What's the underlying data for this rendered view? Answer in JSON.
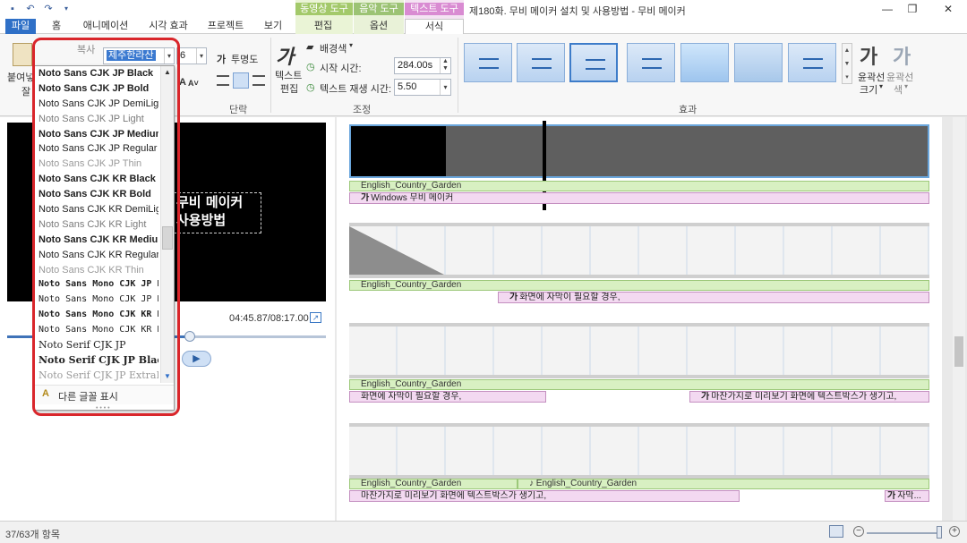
{
  "window": {
    "title": "제180화. 무비 메이커 설치 및 사용방법 - 무비 메이커",
    "min": "—",
    "max": "❐",
    "close": "✕"
  },
  "context_tabs": {
    "video": "동영상 도구",
    "audio": "음악 도구",
    "text": "텍스트 도구"
  },
  "tabs": [
    "파일",
    "홈",
    "애니메이션",
    "시각 효과",
    "프로젝트",
    "보기",
    "편집",
    "옵션",
    "서식"
  ],
  "ribbon": {
    "clipboard": {
      "paste": "붙여넣",
      "copy": "복사",
      "cut": "잘"
    },
    "font": {
      "current": "제주한라산",
      "size": "6",
      "transparency_label": "투명도"
    },
    "paragraph": {
      "label": "단락"
    },
    "adjust": {
      "label": "조정",
      "text_edit_1": "텍스트",
      "text_edit_2": "편집",
      "bg_color": "배경색",
      "start_time_label": "시작 시간:",
      "start_time_value": "284.00s",
      "duration_label": "텍스트 재생 시간:",
      "duration_value": "5.50"
    },
    "effects": {
      "label": "효과"
    },
    "outline_size_1": "윤곽선",
    "outline_size_2": "크기",
    "outline_color_1": "윤곽선",
    "outline_color_2": "색",
    "ga": "가"
  },
  "font_dropdown": {
    "items": [
      "Noto Sans CJK JP Black",
      "Noto Sans CJK JP Bold",
      "Noto Sans CJK JP DemiLight",
      "Noto Sans CJK JP Light",
      "Noto Sans CJK JP Medium",
      "Noto Sans CJK JP Regular",
      "Noto Sans CJK JP Thin",
      "Noto Sans CJK KR Black",
      "Noto Sans CJK KR Bold",
      "Noto Sans CJK KR DemiLight",
      "Noto Sans CJK KR Light",
      "Noto Sans CJK KR Medium",
      "Noto Sans CJK KR Regular",
      "Noto Sans CJK KR Thin",
      "Noto Sans Mono CJK JP Bo",
      "Noto Sans Mono CJK JP Re",
      "Noto Sans Mono CJK KR Bo",
      "Noto Sans Mono CJK KR Re",
      "Noto Serif CJK JP",
      "Noto Serif CJK JP Black",
      "Noto Serif CJK JP ExtraLigl"
    ],
    "more_fonts": "다른 글꼴 표시",
    "scroll_position": 0.55,
    "highlight_color": "#d9262b"
  },
  "preview": {
    "caption_line1": "무비 메이커",
    "caption_line2": "사용방법",
    "time": "04:45.87/08:17.00",
    "progress": 0.574
  },
  "storyboard": {
    "rows": [
      {
        "music": "English_Country_Garden",
        "captions": [
          "Windows 무비 메이커"
        ]
      },
      {
        "music": "English_Country_Garden",
        "captions": [
          "화면에 자막이 필요할 경우,"
        ]
      },
      {
        "music": "English_Country_Garden",
        "captions": [
          "화면에 자막이 필요할 경우,",
          "마찬가지로 미리보기 화면에 텍스트박스가 생기고,"
        ]
      },
      {
        "music": "English_Country_Garden",
        "music2": "English_Country_Garden",
        "captions": [
          "마찬가지로 미리보기 화면에 텍스트박스가 생기고,",
          "자막..."
        ]
      }
    ],
    "caption_icon": "가"
  },
  "status": {
    "item_count": "37/63개 항목",
    "zoom_level": 0.95
  }
}
